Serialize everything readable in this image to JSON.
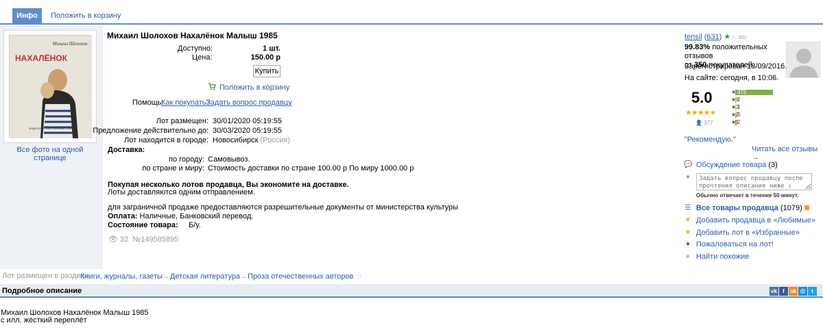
{
  "tabs": {
    "info": "Инфо",
    "cart": "Положить в корзину"
  },
  "photo": {
    "caption": "Все фото на одной странице",
    "book_author": "Михаил Шолохов",
    "book_title": "НАХАЛЁНОК",
    "book_publisher": "ИЗДАТЕЛЬСТВО «МАЛЫШ» 1985"
  },
  "lot": {
    "title": "Михаил Шолохов Нахалёнок Малыш 1985",
    "available_label": "Доступно:",
    "available_value": "1 шт.",
    "price_label": "Цена:",
    "price_value": "150.00 р",
    "buy_button": "Купить",
    "add_to_cart": "Положить в корзину",
    "help_label": "Помощь:",
    "help_how": "Как покупать?",
    "help_ask": "Задать вопрос продавцу",
    "placed_label": "Лот размещен:",
    "placed_value": "30/01/2020 05:19:55",
    "valid_label": "Предложение действительно до:",
    "valid_value": "30/03/2020 05:19:55",
    "city_label": "Лот находится в городе:",
    "city_value": "Новосибирск",
    "city_country": "(Россия)",
    "delivery_heading": "Доставка:",
    "delivery_city_label": "по городу:",
    "delivery_city_value": "Самовывоз.",
    "delivery_world_label": "по стране и миру:",
    "delivery_world_value": "Стоимость доставки по стране 100.00 р По миру 1000.00 р",
    "save_heading": "Покупая несколько лотов продавца, Вы экономите на доставке.",
    "save_text": "Лоты доставляются одним отправлением.",
    "export_note": "для заграничной продаже предоставляются разрешительные документы от министерства культуры",
    "payment_label": "Оплата:",
    "payment_value": "Наличные, Банковский перевод.",
    "condition_label": "Состояние товара:",
    "condition_value": "Б/у.",
    "views": "32",
    "lot_number": "№149585895"
  },
  "seller": {
    "name": "tensil",
    "score": "631",
    "stars_small": "302",
    "positive_pct": "99.83%",
    "positive_text": "положительных отзывов",
    "from_text": "от",
    "buyers_count": "350",
    "buyers_text": "покупателей.",
    "registered": "Зарегистрирован 18/09/2016.",
    "online": "На сайте: сегодня, в 10:06.",
    "rating": "5.0",
    "rating_count": "377",
    "bars": [
      {
        "star": "5",
        "count": "372",
        "color": "#7cb342",
        "fraction": 1.0
      },
      {
        "star": "4",
        "count": "2",
        "color": "#b5cf3a",
        "fraction": 0.02
      },
      {
        "star": "3",
        "count": "1",
        "color": "#f2d43a",
        "fraction": 0.01
      },
      {
        "star": "2",
        "count": "0",
        "color": "#f0a030",
        "fraction": 0.0
      },
      {
        "star": "1",
        "count": "2",
        "color": "#e57345",
        "fraction": 0.02
      }
    ],
    "quote": "\"Рекомендую.\"",
    "read_all": "Читать все отзывы →",
    "discussion_label": "Обсуждение товара",
    "discussion_count": "(3)",
    "question_placeholder": "Задать вопрос продавцу после прочтения описания ниже ↓",
    "answer_time": "Обычно отвечает в течение 50 минут.",
    "all_lots_label": "Все товары продавца",
    "all_lots_count": "(1079)",
    "add_favorite_seller": "Добавить продавца в «Любимые»",
    "add_favorite_lot": "Добавить лот в «Избранные»",
    "complain": "Пожаловаться на лот!",
    "find_similar": "Найти похожие"
  },
  "section": {
    "label": "Лот размещен в разделе",
    "crumbs": [
      "Книги, журналы, газеты",
      "Детская литература",
      "Проза отечественных авторов"
    ],
    "sep": "→"
  },
  "description": {
    "heading": "Подробное описание",
    "line1": "Михаил Шолохов Нахалёнок Малыш 1985",
    "line2": "с илл. жёсткий переплёт"
  },
  "share": [
    {
      "name": "vk",
      "glyph": "vk",
      "color": "#4a76a8"
    },
    {
      "name": "facebook",
      "glyph": "f",
      "color": "#3b5998"
    },
    {
      "name": "odnoklassniki",
      "glyph": "ok",
      "color": "#f08a24"
    },
    {
      "name": "moimir",
      "glyph": "@",
      "color": "#168de2"
    },
    {
      "name": "twitter",
      "glyph": "t",
      "color": "#1da1f2"
    }
  ]
}
